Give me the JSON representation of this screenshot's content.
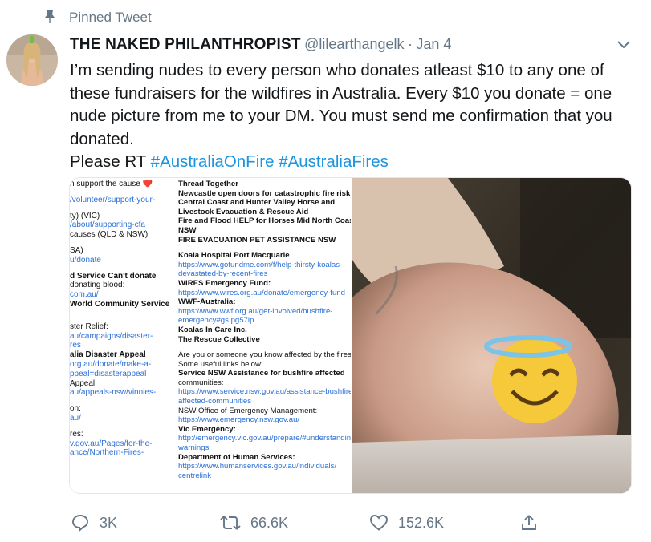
{
  "pinned": {
    "label": "Pinned Tweet",
    "icon": "pin-icon"
  },
  "author": {
    "name": "THE NAKED PHILANTHROPIST",
    "handle": "@lilearthangelk",
    "separator": "·",
    "date": "Jan 4"
  },
  "tweet": {
    "text": "I’m sending nudes to every person who donates atleast $10 to any one of these fundraisers for the wildfires in Australia. Every $10 you donate = one nude picture from me to your DM. You must send me confirmation that you donated.",
    "rt_prefix": "Please RT",
    "hashtags": [
      "#AustraliaOnFire",
      "#AustraliaFires"
    ]
  },
  "media": {
    "left_image_col1": [
      {
        "t": "n support the cause ❤️",
        "s": "plain"
      },
      {
        "t": "",
        "s": "gap"
      },
      {
        "t": "/volunteer/support-your-",
        "s": "link"
      },
      {
        "t": "",
        "s": "gap"
      },
      {
        "t": "ty) (VIC)",
        "s": "plain"
      },
      {
        "t": "/about/supporting-cfa",
        "s": "link"
      },
      {
        "t": "causes (QLD & NSW)",
        "s": "plain"
      },
      {
        "t": "",
        "s": "gap"
      },
      {
        "t": "SA)",
        "s": "plain"
      },
      {
        "t": "u/donate",
        "s": "link"
      },
      {
        "t": "",
        "s": "gap"
      },
      {
        "t": "d Service Can't donate",
        "s": "bold"
      },
      {
        "t": "donating blood:",
        "s": "plain"
      },
      {
        "t": "com.au/",
        "s": "link"
      },
      {
        "t": "World Community Service",
        "s": "bold"
      },
      {
        "t": "",
        "s": "gap"
      },
      {
        "t": "",
        "s": "gap"
      },
      {
        "t": "ster Relief:",
        "s": "plain"
      },
      {
        "t": "au/campaigns/disaster-",
        "s": "link"
      },
      {
        "t": "res",
        "s": "link"
      },
      {
        "t": "alia Disaster Appeal",
        "s": "bold"
      },
      {
        "t": "org.au/donate/make-a-",
        "s": "link"
      },
      {
        "t": "ppeal=disasterappeal",
        "s": "link"
      },
      {
        "t": "Appeal:",
        "s": "plain"
      },
      {
        "t": "au/appeals-nsw/vinnies-",
        "s": "link"
      },
      {
        "t": "",
        "s": "gap"
      },
      {
        "t": "on:",
        "s": "plain"
      },
      {
        "t": "au/",
        "s": "link"
      },
      {
        "t": "",
        "s": "gap"
      },
      {
        "t": "res:",
        "s": "plain"
      },
      {
        "t": "v.gov.au/Pages/for-the-",
        "s": "link"
      },
      {
        "t": "ance/Northern-Fires-",
        "s": "link"
      }
    ],
    "left_image_col2": [
      {
        "t": "Thread Together",
        "s": "bold"
      },
      {
        "t": "Newcastle open doors for catastrophic fire risk",
        "s": "bold"
      },
      {
        "t": "Central Coast and Hunter Valley Horse and",
        "s": "bold"
      },
      {
        "t": "Livestock Evacuation & Rescue Aid",
        "s": "bold"
      },
      {
        "t": "Fire and Flood HELP for Horses Mid North Coast",
        "s": "bold"
      },
      {
        "t": "NSW",
        "s": "bold"
      },
      {
        "t": "FIRE EVACUATION PET ASSISTANCE NSW",
        "s": "bold"
      },
      {
        "t": "",
        "s": "gap"
      },
      {
        "t": "Koala Hospital Port Macquarie",
        "s": "bold"
      },
      {
        "t": "https://www.gofundme.com/f/help-thirsty-koalas-",
        "s": "link"
      },
      {
        "t": "devastated-by-recent-fires",
        "s": "link"
      },
      {
        "t": "WIRES Emergency Fund:",
        "s": "bold"
      },
      {
        "t": "https://www.wires.org.au/donate/emergency-fund",
        "s": "link"
      },
      {
        "t": "WWF-Australia:",
        "s": "bold"
      },
      {
        "t": "https://www.wwf.org.au/get-involved/bushfire-",
        "s": "link"
      },
      {
        "t": "emergency#gs.pg57ip",
        "s": "link"
      },
      {
        "t": "Koalas In Care Inc.",
        "s": "bold"
      },
      {
        "t": "The Rescue Collective",
        "s": "bold"
      },
      {
        "t": "",
        "s": "gap"
      },
      {
        "t": "Are you or someone you know affected by the fires?",
        "s": "plain"
      },
      {
        "t": "Some useful links below:",
        "s": "plain"
      },
      {
        "t": "Service NSW Assistance for bushfire affected",
        "s": "bold"
      },
      {
        "t": "communities:",
        "s": "plain"
      },
      {
        "t": "https://www.service.nsw.gov.au/assistance-bushfire-",
        "s": "link"
      },
      {
        "t": "affected-communities",
        "s": "link"
      },
      {
        "t": "NSW Office of Emergency Management:",
        "s": "plain"
      },
      {
        "t": "https://www.emergency.nsw.gov.au/",
        "s": "link"
      },
      {
        "t": "Vic Emergency:",
        "s": "bold"
      },
      {
        "t": "http://emergency.vic.gov.au/prepare/#understanding-",
        "s": "link"
      },
      {
        "t": "warnings",
        "s": "link"
      },
      {
        "t": "Department of Human Services:",
        "s": "bold"
      },
      {
        "t": "https://www.humanservices.gov.au/individuals/",
        "s": "link"
      },
      {
        "t": "centrelink",
        "s": "link"
      }
    ],
    "right_image_overlay": "smiling-face-with-halo-emoji"
  },
  "actions": {
    "reply_count": "3K",
    "retweet_count": "66.6K",
    "like_count": "152.6K"
  },
  "colors": {
    "link": "#1b95e0",
    "secondary_text": "#657786",
    "primary_text": "#14171a"
  }
}
